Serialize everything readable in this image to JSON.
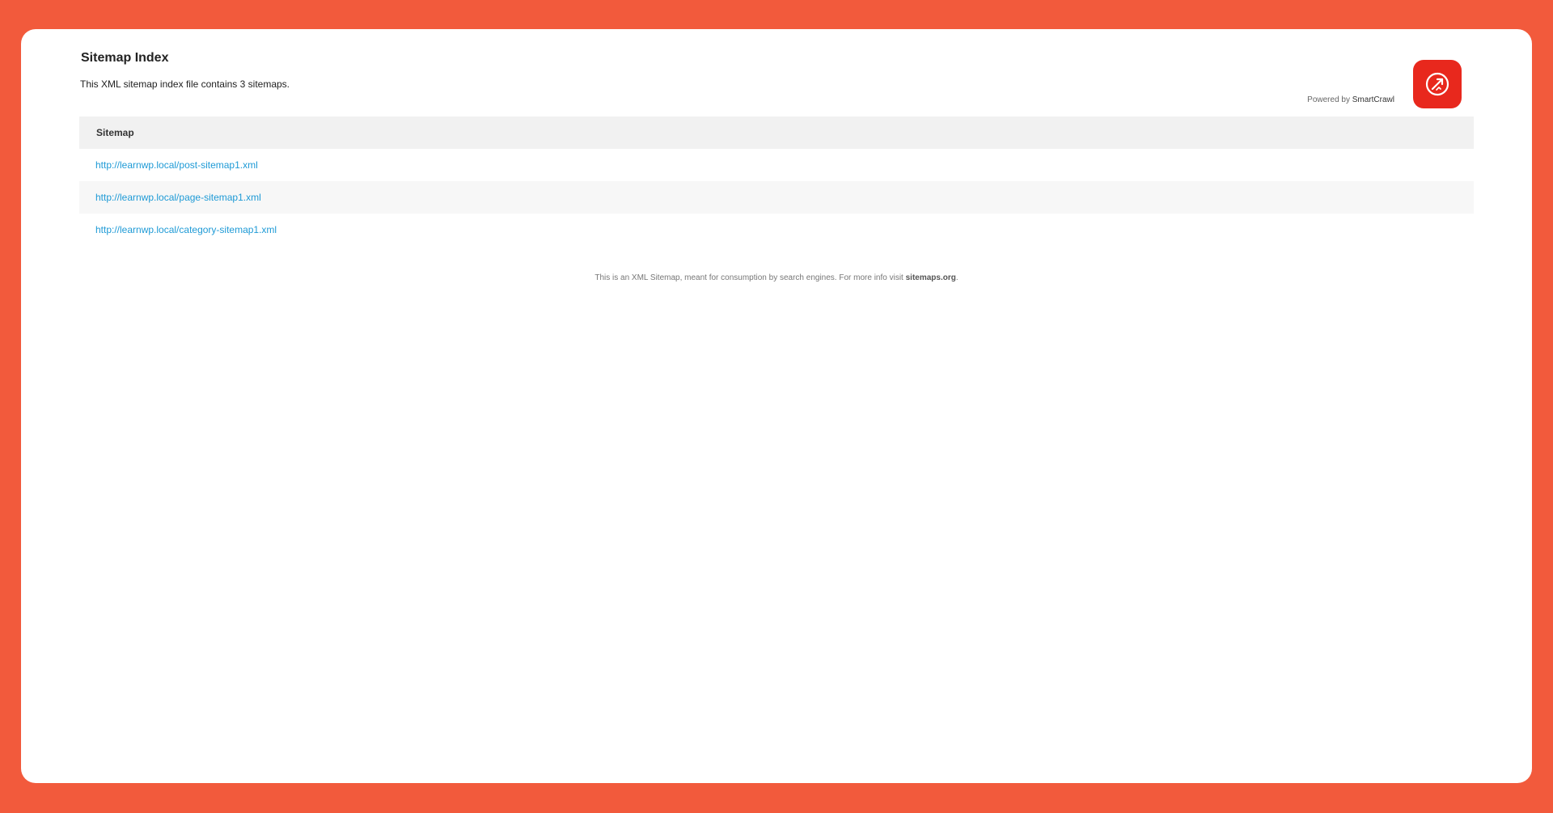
{
  "page": {
    "title": "Sitemap Index",
    "description": "This XML sitemap index file contains 3 sitemaps.",
    "powered_by_prefix": "Powered by ",
    "powered_by_brand": "SmartCrawl",
    "brand_color": "#e8281d",
    "background_color": "#f25a3c",
    "logo_icon": "smartcrawl-logo-icon"
  },
  "table": {
    "header": "Sitemap",
    "rows": [
      {
        "url": "http://learnwp.local/post-sitemap1.xml"
      },
      {
        "url": "http://learnwp.local/page-sitemap1.xml"
      },
      {
        "url": "http://learnwp.local/category-sitemap1.xml"
      }
    ],
    "link_color": "#1e9ad6"
  },
  "footer": {
    "text": "This is an XML Sitemap, meant for consumption by search engines. For more info visit ",
    "link_text": "sitemaps.org",
    "suffix": "."
  }
}
